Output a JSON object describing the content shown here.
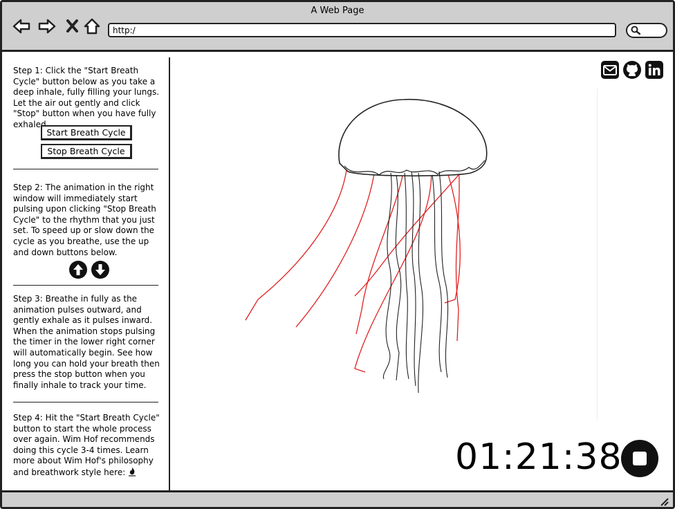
{
  "window": {
    "title": "A Web Page",
    "url": "http:/"
  },
  "nav": {
    "back_icon": "back-arrow-icon",
    "forward_icon": "forward-arrow-icon",
    "close_icon": "close-icon",
    "home_icon": "home-icon",
    "search_icon": "search-icon"
  },
  "sidebar": {
    "step1": "Step 1: Click the \"Start Breath Cycle\" button below as you take a deep inhale, fully filling your lungs. Let the air out gently and click \"Stop\" button when you have fully exhaled.",
    "start_button": "Start Breath Cycle",
    "stop_button": "Stop Breath Cycle",
    "step2": "Step 2: The animation in the right window will immediately start pulsing upon clicking \"Stop Breath Cycle\" to the rhythm that you just set. To speed up or slow down the cycle as you breathe, use the up and down buttons below.",
    "step3": "Step 3: Breathe in fully as the animation pulses outward, and gently exhale as it pulses inward. When the animation stops pulsing the timer in the lower right corner will automatically begin. See how long you can hold your breath then press the stop button when you finally inhale to track your time.",
    "step4": "Step 4: Hit the \"Start Breath Cycle\" button to start the whole process over again. Wim Hof recommends doing this cycle 3-4 times. Learn more about Wim Hof's philosophy and breathwork style here:"
  },
  "social": {
    "icons": [
      "envelope-icon",
      "github-icon",
      "linkedin-icon"
    ]
  },
  "timer": {
    "value": "01:21:38"
  },
  "colors": {
    "chrome": "#cfcfcf",
    "border": "#222222",
    "tentacle": "#e02020"
  }
}
